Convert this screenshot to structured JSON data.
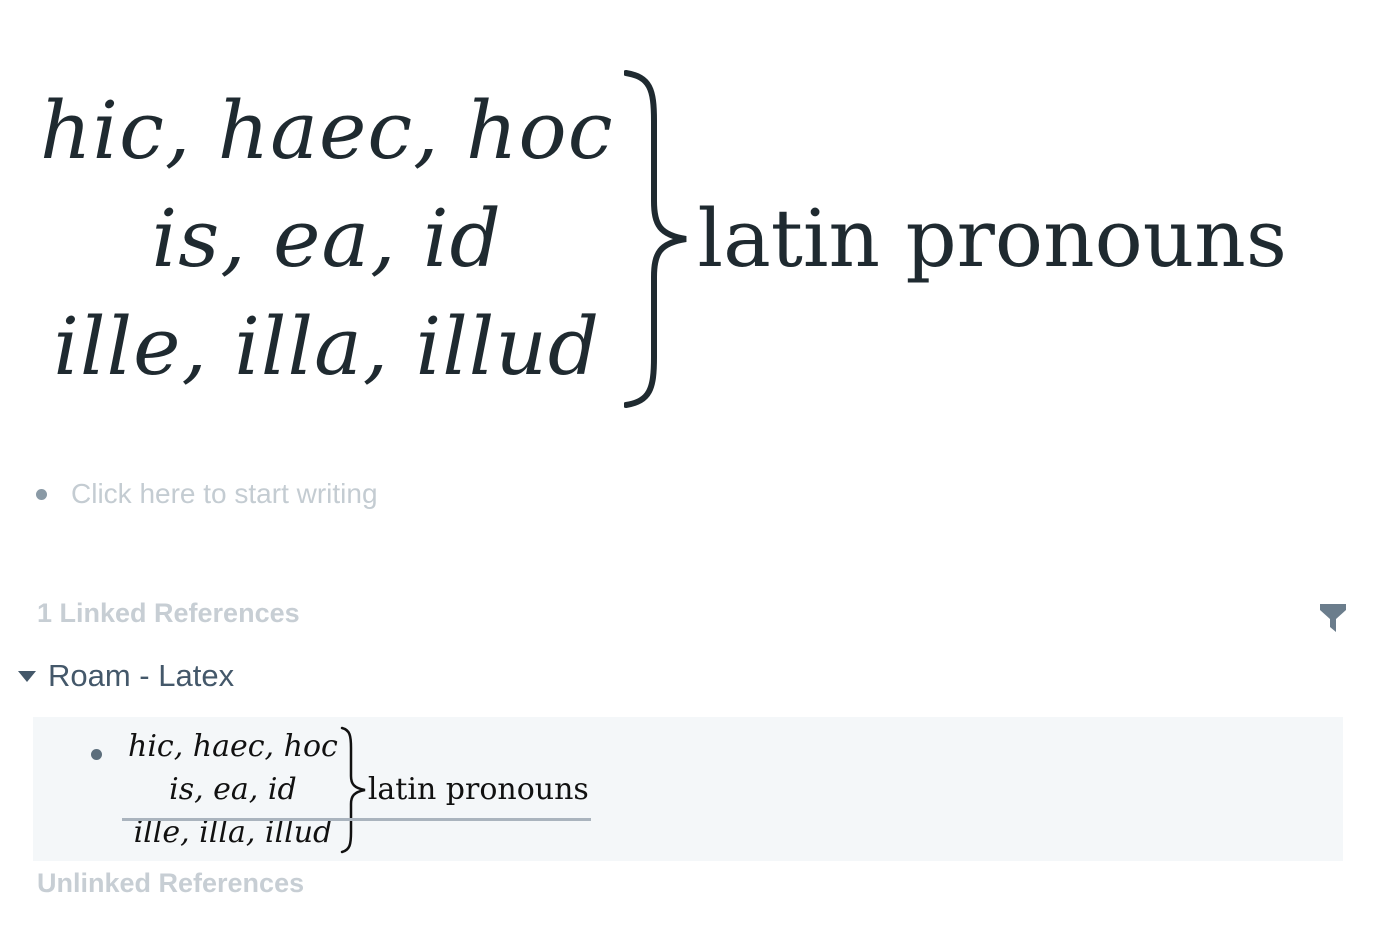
{
  "page_title": {
    "math_lines": [
      "hic, haec, hoc",
      "is, ea, id",
      "ille, illa, illud"
    ],
    "caption": "latin pronouns"
  },
  "empty_block": {
    "placeholder": "Click here to start writing"
  },
  "linked_references": {
    "header": "1 Linked References",
    "filter_icon": "filter-icon",
    "groups": [
      {
        "page_link": "Roam - Latex",
        "blocks": [
          {
            "math_lines": [
              "hic, haec, hoc",
              "is, ea, id",
              "ille, illa, illud"
            ],
            "caption": "latin pronouns"
          }
        ]
      }
    ]
  },
  "unlinked_references": {
    "header": "Unlinked References"
  },
  "colors": {
    "text_dark": "#1f2a30",
    "muted_header": "#c7ced4",
    "link": "#44586a",
    "reference_bg": "#f4f7f9"
  }
}
